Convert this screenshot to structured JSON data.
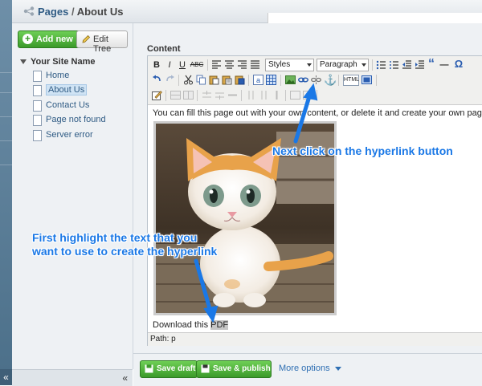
{
  "header": {
    "breadcrumb_root": "Pages",
    "breadcrumb_sep": "/",
    "breadcrumb_current": "About Us"
  },
  "sidebar": {
    "add_new_label": "Add new",
    "edit_tree_label": "Edit Tree",
    "root_label": "Your Site Name",
    "items": [
      {
        "label": "Home"
      },
      {
        "label": "About Us"
      },
      {
        "label": "Contact Us"
      },
      {
        "label": "Page not found"
      },
      {
        "label": "Server error"
      }
    ],
    "collapse_glyph": "«"
  },
  "strip": {
    "collapse_glyph": "«"
  },
  "editor": {
    "section_label": "Content",
    "toolbar": {
      "bold": "B",
      "italic": "I",
      "underline": "U",
      "strike": "ABC",
      "styles_select": "Styles",
      "format_select": "Paragraph",
      "html_button": "HTML"
    },
    "body_text": "You can fill this page out with your own content, or delete it and create your own pages.",
    "download_prefix": "Download this ",
    "download_highlight": "PDF",
    "path_text": "Path: p"
  },
  "footer": {
    "save_draft_label": "Save draft",
    "save_publish_label": "Save & publish",
    "more_options_label": "More options"
  },
  "callouts": {
    "next_click": "Next click on the hyperlink button",
    "first_highlight_line1": "First highlight the text that you",
    "first_highlight_line2": "want to use to create the hyperlink"
  },
  "colors": {
    "accent_blue": "#1a78e6",
    "green_button": "#3b9a2a",
    "link_blue": "#2f5b84"
  }
}
